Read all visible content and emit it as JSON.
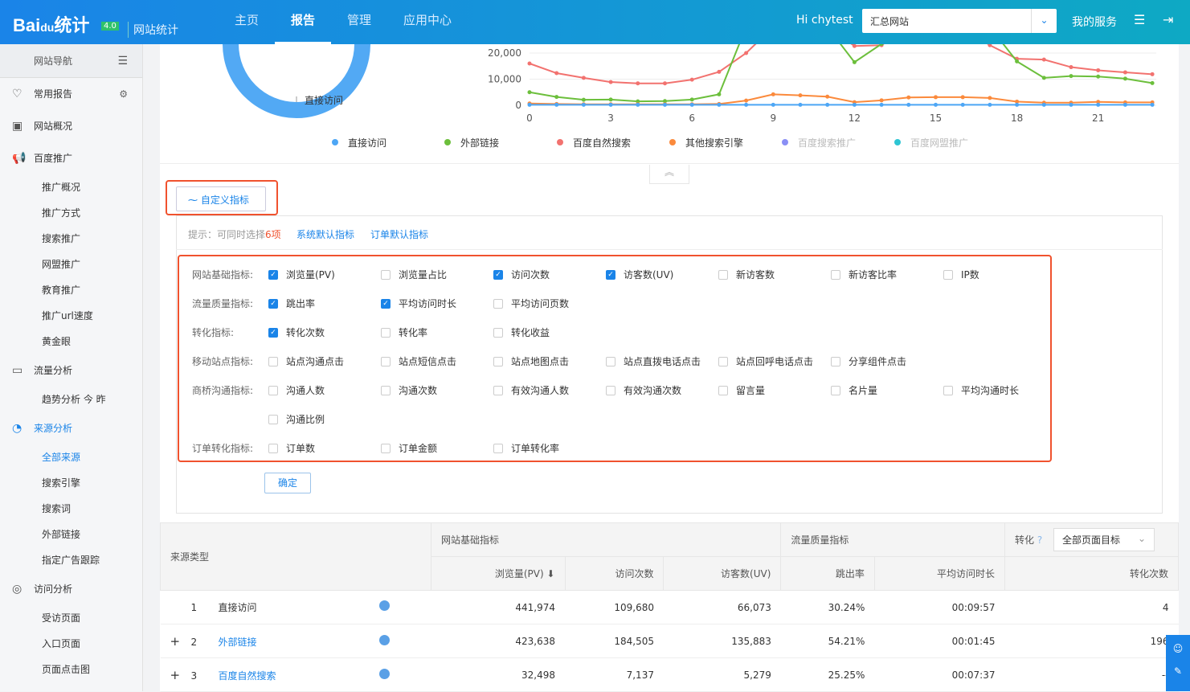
{
  "header": {
    "logo": "Bai du统计",
    "version": "4.0",
    "product": "网站统计",
    "nav": [
      "主页",
      "报告",
      "管理",
      "应用中心"
    ],
    "active_nav": "报告",
    "greeting": "Hi chytest",
    "site_select": "汇总网站",
    "services": "我的服务"
  },
  "sidebar": {
    "title": "网站导航",
    "items": [
      {
        "label": "常用报告",
        "type": "group",
        "icon": "heart-icon"
      },
      {
        "label": "网站概况",
        "type": "group",
        "icon": "overview-icon"
      },
      {
        "label": "百度推广",
        "type": "group",
        "icon": "megaphone-icon"
      },
      {
        "label": "推广概况",
        "type": "sub"
      },
      {
        "label": "推广方式",
        "type": "sub"
      },
      {
        "label": "搜索推广",
        "type": "sub"
      },
      {
        "label": "网盟推广",
        "type": "sub"
      },
      {
        "label": "教育推广",
        "type": "sub"
      },
      {
        "label": "推广url速度",
        "type": "sub"
      },
      {
        "label": "黄金眼",
        "type": "sub"
      },
      {
        "label": "流量分析",
        "type": "group",
        "icon": "monitor-icon"
      },
      {
        "label": "趋势分析   今   昨",
        "type": "sub"
      },
      {
        "label": "来源分析",
        "type": "group",
        "icon": "pie-icon",
        "active": true
      },
      {
        "label": "全部来源",
        "type": "sub",
        "active": true
      },
      {
        "label": "搜索引擎",
        "type": "sub"
      },
      {
        "label": "搜索词",
        "type": "sub"
      },
      {
        "label": "外部链接",
        "type": "sub"
      },
      {
        "label": "指定广告跟踪",
        "type": "sub"
      },
      {
        "label": "访问分析",
        "type": "group",
        "icon": "spiral-icon"
      },
      {
        "label": "受访页面",
        "type": "sub"
      },
      {
        "label": "入口页面",
        "type": "sub"
      },
      {
        "label": "页面点击图",
        "type": "sub"
      }
    ]
  },
  "pie_label": "直接访问",
  "chart_data": {
    "type": "line",
    "x": [
      0,
      1,
      2,
      3,
      4,
      5,
      6,
      7,
      8,
      9,
      10,
      11,
      12,
      13,
      14,
      15,
      16,
      17,
      18,
      19,
      20,
      21,
      22,
      23
    ],
    "xticks": [
      0,
      3,
      6,
      9,
      12,
      15,
      18,
      21
    ],
    "yticks": [
      "0",
      "10,000",
      "20,000"
    ],
    "ylim": [
      0,
      23500
    ],
    "grid": true,
    "legend": "bottom",
    "series": [
      {
        "name": "直接访问",
        "color": "#4da6f5",
        "values": [
          200,
          200,
          200,
          200,
          200,
          200,
          200,
          200,
          200,
          200,
          200,
          200,
          200,
          200,
          200,
          200,
          200,
          200,
          200,
          200,
          200,
          200,
          200,
          200
        ]
      },
      {
        "name": "外部链接",
        "color": "#6cbf3c",
        "values": [
          5000,
          3200,
          2100,
          2200,
          1500,
          1600,
          2200,
          4200,
          30000,
          30000,
          30000,
          30000,
          16500,
          23500,
          30000,
          30000,
          30000,
          30000,
          16800,
          10500,
          11200,
          11000,
          10200,
          8500
        ]
      },
      {
        "name": "百度自然搜索",
        "color": "#f2726f",
        "values": [
          16000,
          12300,
          10500,
          8900,
          8400,
          8400,
          9800,
          12800,
          20000,
          30000,
          30000,
          30000,
          22700,
          23000,
          30000,
          30000,
          30000,
          23000,
          17800,
          17500,
          14600,
          13400,
          12600,
          11900
        ]
      },
      {
        "name": "其他搜索引擎",
        "color": "#fb8a3c",
        "values": [
          700,
          500,
          400,
          400,
          400,
          400,
          400,
          500,
          1800,
          4200,
          3800,
          3300,
          1200,
          1900,
          3000,
          3100,
          3100,
          2800,
          1400,
          1000,
          1000,
          1300,
          1100,
          1100
        ]
      },
      {
        "name": "百度搜索推广",
        "color": "#8a8ff5",
        "disabled": true,
        "values": []
      },
      {
        "name": "百度网盟推广",
        "color": "#2ec5d3",
        "disabled": true,
        "values": []
      }
    ]
  },
  "custom": {
    "button": "自定义指标",
    "tip": "提示：可同时选择",
    "tip_n": "6项",
    "link1": "系统默认指标",
    "link2": "订单默认指标",
    "confirm": "确定",
    "rows": [
      {
        "label": "网站基础指标:",
        "items": [
          [
            "浏览量(PV)",
            true
          ],
          [
            "浏览量占比",
            false
          ],
          [
            "访问次数",
            true
          ],
          [
            "访客数(UV)",
            true
          ],
          [
            "新访客数",
            false
          ],
          [
            "新访客比率",
            false
          ],
          [
            "IP数",
            false
          ]
        ]
      },
      {
        "label": "流量质量指标:",
        "items": [
          [
            "跳出率",
            true
          ],
          [
            "平均访问时长",
            true
          ],
          [
            "平均访问页数",
            false
          ]
        ]
      },
      {
        "label": "转化指标:",
        "items": [
          [
            "转化次数",
            true
          ],
          [
            "转化率",
            false
          ],
          [
            "转化收益",
            false
          ]
        ]
      },
      {
        "label": "移动站点指标:",
        "items": [
          [
            "站点沟通点击",
            false
          ],
          [
            "站点短信点击",
            false
          ],
          [
            "站点地图点击",
            false
          ],
          [
            "站点直拨电话点击",
            false
          ],
          [
            "站点回呼电话点击",
            false
          ],
          [
            "分享组件点击",
            false
          ]
        ]
      },
      {
        "label": "商桥沟通指标:",
        "items": [
          [
            "沟通人数",
            false
          ],
          [
            "沟通次数",
            false
          ],
          [
            "有效沟通人数",
            false
          ],
          [
            "有效沟通次数",
            false
          ],
          [
            "留言量",
            false
          ],
          [
            "名片量",
            false
          ],
          [
            "平均沟通时长",
            false
          ]
        ]
      },
      {
        "label": "",
        "items": [
          [
            "沟通比例",
            false
          ]
        ]
      },
      {
        "label": "订单转化指标:",
        "items": [
          [
            "订单数",
            false
          ],
          [
            "订单金额",
            false
          ],
          [
            "订单转化率",
            false
          ]
        ]
      }
    ]
  },
  "table": {
    "col_source": "来源类型",
    "grp1": "网站基础指标",
    "grp2": "流量质量指标",
    "grp3": "转化",
    "goal_select": "全部页面目标",
    "cols": [
      "浏览量(PV) ⬇",
      "访问次数",
      "访客数(UV)",
      "跳出率",
      "平均访问时长",
      "转化次数"
    ],
    "rows": [
      {
        "expand": "",
        "idx": "1",
        "name": "直接访问",
        "link": false,
        "v": [
          "441,974",
          "109,680",
          "66,073",
          "30.24%",
          "00:09:57",
          "4"
        ]
      },
      {
        "expand": "+",
        "idx": "2",
        "name": "外部链接",
        "link": true,
        "v": [
          "423,638",
          "184,505",
          "135,883",
          "54.21%",
          "00:01:45",
          "196"
        ]
      },
      {
        "expand": "+",
        "idx": "3",
        "name": "百度自然搜索",
        "link": true,
        "v": [
          "32,498",
          "7,137",
          "5,279",
          "25.25%",
          "00:07:37",
          "--"
        ]
      }
    ]
  }
}
